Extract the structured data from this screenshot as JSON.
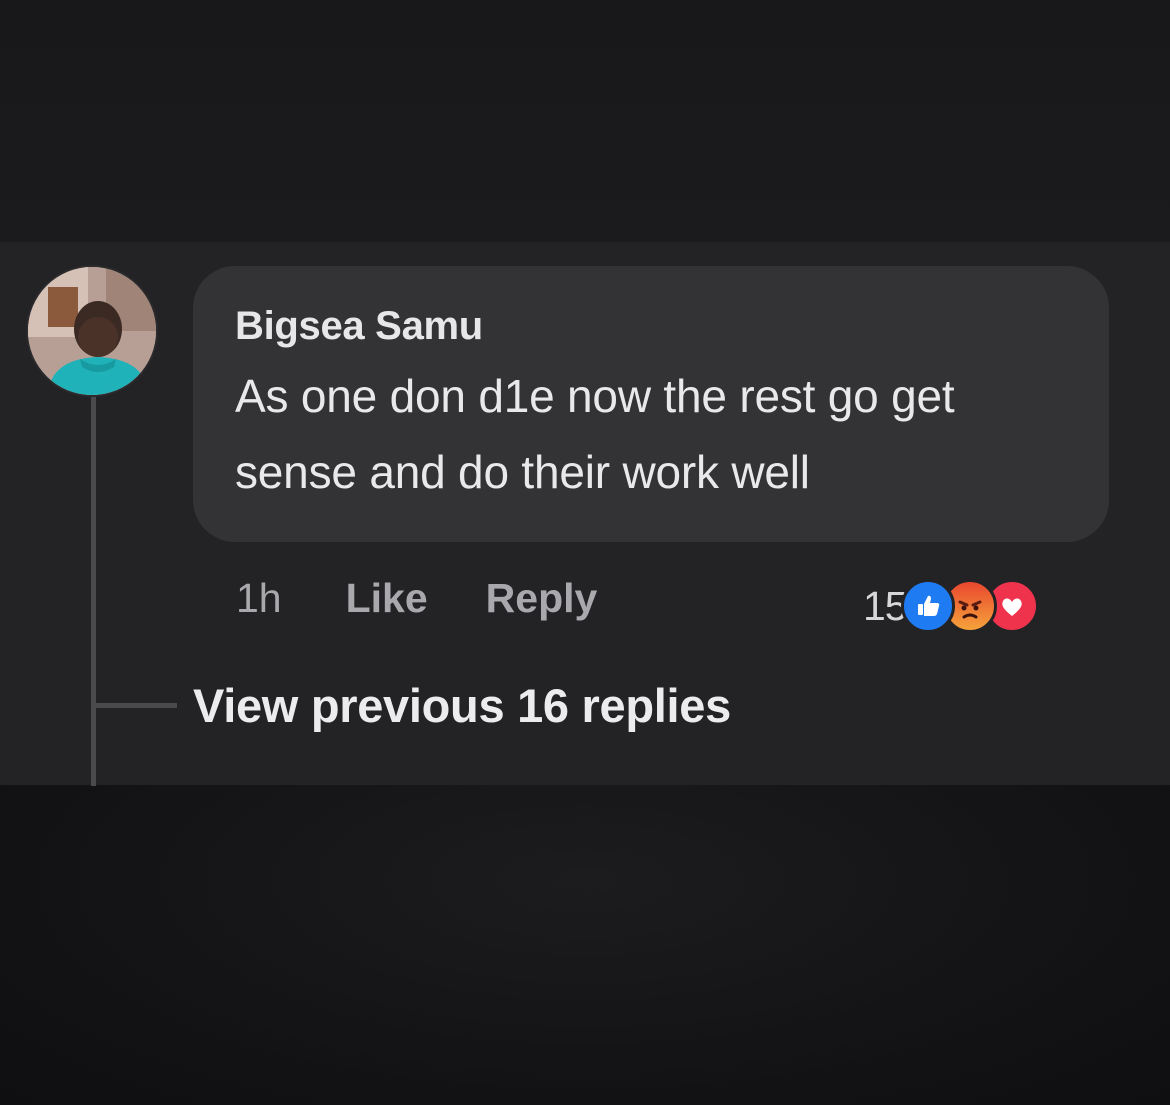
{
  "comment": {
    "author": "Bigsea Samu",
    "text": "As one don d1e now the rest go get sense and do their work well",
    "avatar_icon": "profile-photo",
    "actions": {
      "time": "1h",
      "like_label": "Like",
      "reply_label": "Reply"
    },
    "reactions": {
      "count": "15",
      "types": [
        "like-reaction-icon",
        "angry-reaction-icon",
        "love-reaction-icon"
      ],
      "colors": {
        "like": "#1f7bf2",
        "angry": "#f08a35",
        "love": "#f0334d"
      }
    }
  },
  "thread": {
    "view_previous_label": "View previous 16 replies"
  },
  "theme": {
    "panel_bg": "#232325",
    "bubble_bg": "#333336",
    "page_bg": "#151517"
  }
}
